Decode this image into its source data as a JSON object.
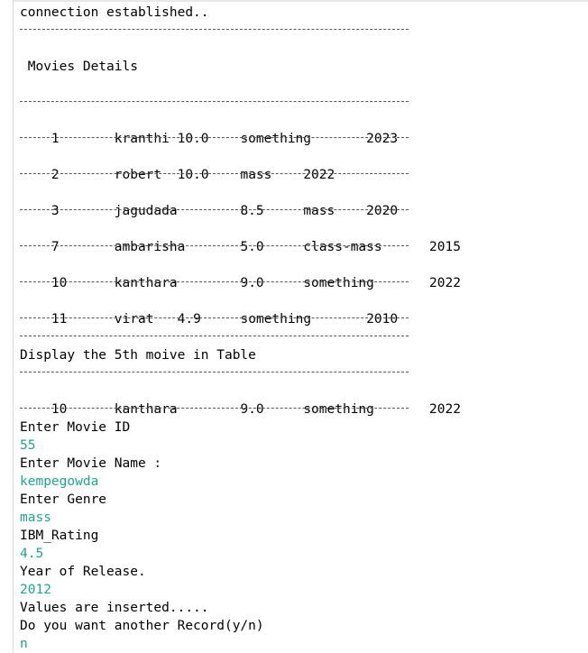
{
  "status": "connection established..",
  "section_title": " Movies Details",
  "movies": [
    {
      "id": "1",
      "name": "kranthi",
      "rating": "10.0",
      "genre": "something",
      "year": "2023"
    },
    {
      "id": "2",
      "name": "robert",
      "rating": "10.0",
      "genre": "mass",
      "year": "2022"
    },
    {
      "id": "3",
      "name": "jagudada",
      "rating": "8.5",
      "genre": "mass",
      "year": "2020"
    },
    {
      "id": "7",
      "name": "ambarisha",
      "rating": "5.0",
      "genre": "class-mass",
      "year": "2015"
    },
    {
      "id": "10",
      "name": "kanthara",
      "rating": "9.0",
      "genre": "something",
      "year": "2022"
    },
    {
      "id": "11",
      "name": "virat",
      "rating": "4.9",
      "genre": "something",
      "year": "2010"
    }
  ],
  "fifth_title": "Display the 5th moive in Table",
  "fifth_movie": {
    "id": "10",
    "name": "kanthara",
    "rating": "9.0",
    "genre": "something",
    "year": "2022"
  },
  "prompts": {
    "id_prompt": "Enter Movie ID",
    "id_value": "55",
    "name_prompt": "Enter Movie Name :",
    "name_value": "kempegowda",
    "genre_prompt": "Enter Genre",
    "genre_value": "mass",
    "rating_prompt": "IBM_Rating",
    "rating_value": "4.5",
    "year_prompt": "Year of Release.",
    "year_value": "2012",
    "inserted_msg": "Values are inserted.....",
    "another_prompt": "Do you want another Record(y/n)",
    "another_value": "n"
  },
  "colors": {
    "input_text": "#1fa58a",
    "output_text": "#000000",
    "background": "#ffffff"
  }
}
